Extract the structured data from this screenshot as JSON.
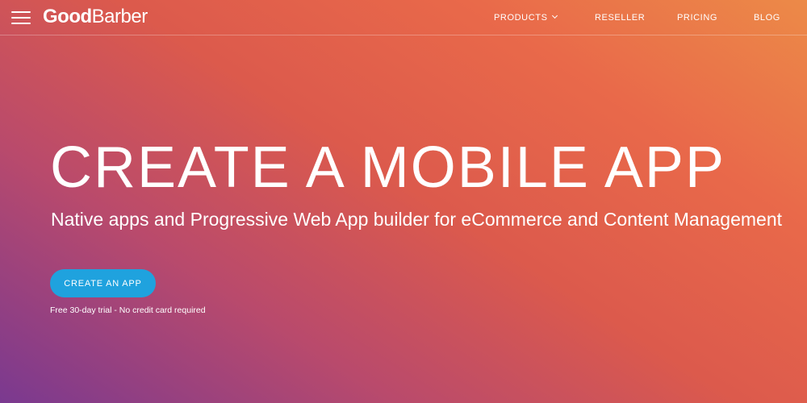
{
  "header": {
    "logo_good": "Good",
    "logo_barber": "Barber",
    "nav": [
      {
        "label": "PRODUCTS",
        "icon": "chevron-down-icon"
      },
      {
        "label": "RESELLER"
      },
      {
        "label": "PRICING"
      },
      {
        "label": "BLOG"
      }
    ],
    "menu_icon": "hamburger-icon"
  },
  "hero": {
    "title": "CREATE A MOBILE APP",
    "subtitle": "Native apps and Progressive Web App builder for eCommerce and Content Management",
    "cta_label": "CREATE AN APP",
    "note": "Free 30-day trial - No credit card required"
  },
  "colors": {
    "gradient_start": "#7a3990",
    "gradient_mid": "#dc5a4c",
    "gradient_end": "#ec8a48",
    "cta_background": "#1fa2de",
    "text": "#ffffff"
  }
}
